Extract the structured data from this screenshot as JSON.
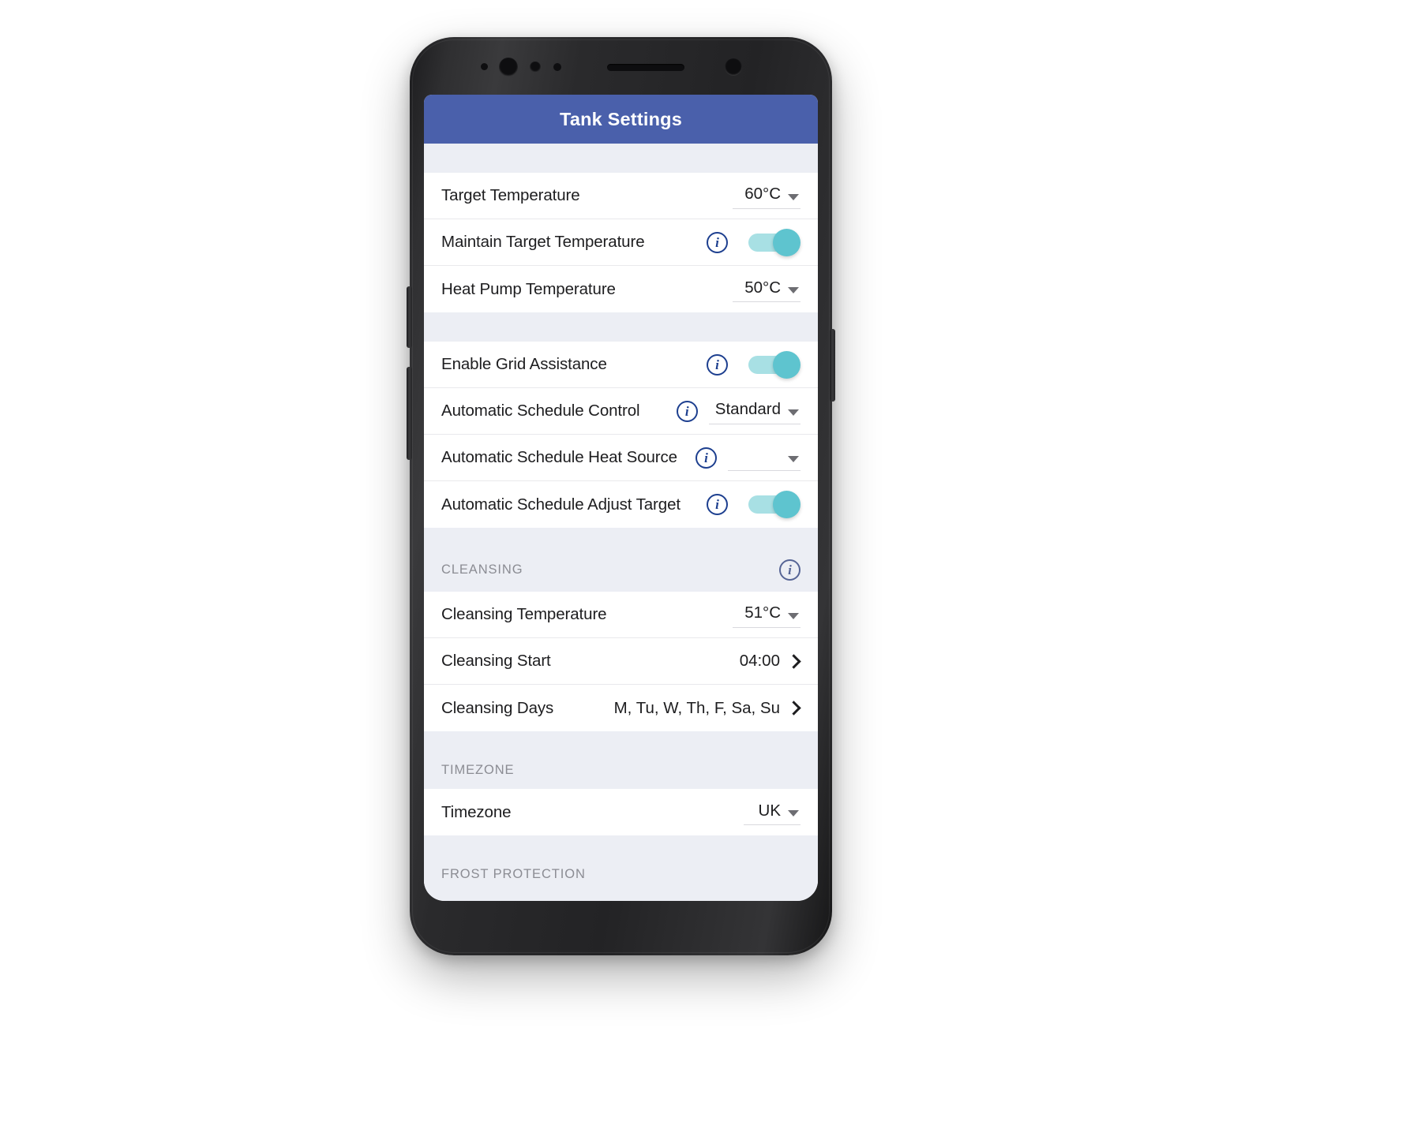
{
  "app": {
    "title": "Tank Settings",
    "header_color": "#4a60ab",
    "toggle_on_color": "#5ec4cf",
    "toggle_track_color": "#a8e0e4",
    "info_icon_color": "#1d3f8f",
    "icons": {
      "info": "info-icon",
      "caret": "chevron-down-icon",
      "disclosure": "chevron-right-icon"
    }
  },
  "sections": [
    {
      "id": "temperature",
      "caption": "",
      "rows": [
        {
          "label": "Target Temperature",
          "value": "60°C",
          "control": "dropdown"
        },
        {
          "label": "Maintain Target Temperature",
          "value": "",
          "control": "toggle",
          "info": true,
          "toggle_on": true
        },
        {
          "label": "Heat Pump Temperature",
          "value": "50°C",
          "control": "dropdown"
        }
      ]
    },
    {
      "id": "grid",
      "caption": "",
      "rows": [
        {
          "label": "Enable Grid Assistance",
          "value": "",
          "control": "toggle",
          "info": true,
          "toggle_on": true
        },
        {
          "label": "Automatic Schedule Control",
          "value": "Standard",
          "control": "dropdown",
          "info": true
        },
        {
          "label": "Automatic Schedule Heat Source",
          "value": "",
          "control": "dropdown",
          "info": true
        },
        {
          "label": "Automatic Schedule Adjust Target",
          "value": "",
          "control": "toggle",
          "info": true,
          "toggle_on": true
        }
      ]
    },
    {
      "id": "cleansing",
      "caption": "CLEANSING",
      "caption_info": true,
      "rows": [
        {
          "label": "Cleansing Temperature",
          "value": "51°C",
          "control": "dropdown"
        },
        {
          "label": "Cleansing Start",
          "value": "04:00",
          "control": "chevron"
        },
        {
          "label": "Cleansing Days",
          "value": "M, Tu, W, Th, F, Sa, Su",
          "control": "chevron"
        }
      ]
    },
    {
      "id": "timezone",
      "caption": "TIMEZONE",
      "caption_info": false,
      "rows": [
        {
          "label": "Timezone",
          "value": "UK",
          "control": "dropdown"
        }
      ]
    },
    {
      "id": "frost",
      "caption": "FROST PROTECTION",
      "caption_info": false,
      "rows": []
    }
  ]
}
